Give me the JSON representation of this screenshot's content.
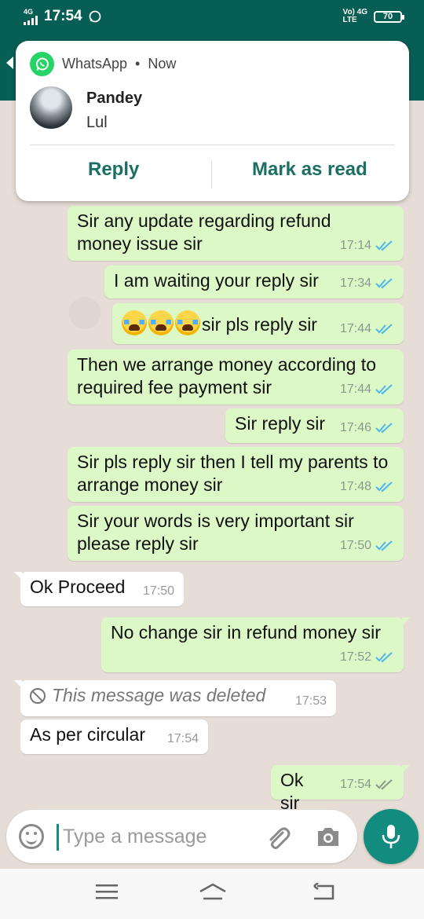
{
  "status_bar": {
    "network_small": "4G",
    "time": "17:54",
    "volte": "Vo) 4G",
    "lte": "LTE",
    "battery": "70"
  },
  "notification": {
    "app": "WhatsApp",
    "sep": "•",
    "when": "Now",
    "sender": "Pandey",
    "message": "Lul",
    "reply_label": "Reply",
    "mark_read_label": "Mark as read"
  },
  "messages": [
    {
      "dir": "out",
      "text": "Sir any update regarding refund money issue sir",
      "time": "17:14",
      "status": "read"
    },
    {
      "dir": "out",
      "text": "I am waiting your reply sir",
      "time": "17:34",
      "status": "read"
    },
    {
      "dir": "out",
      "emoji": "crying-face x3",
      "text": "sir pls reply sir",
      "time": "17:44",
      "status": "read"
    },
    {
      "dir": "out",
      "text": "Then we arrange money according to required fee payment sir",
      "time": "17:44",
      "status": "read"
    },
    {
      "dir": "out",
      "text": "Sir reply sir",
      "time": "17:46",
      "status": "read"
    },
    {
      "dir": "out",
      "text": "Sir pls reply sir then I tell my parents to arrange money sir",
      "time": "17:48",
      "status": "read"
    },
    {
      "dir": "out",
      "text": "Sir your words is very important sir please reply sir",
      "time": "17:50",
      "status": "read"
    },
    {
      "dir": "in",
      "text": "Ok Proceed",
      "time": "17:50"
    },
    {
      "dir": "out",
      "text": "No change sir in refund money sir",
      "time": "17:52",
      "status": "read"
    },
    {
      "dir": "in",
      "text": "This message was deleted",
      "time": "17:53",
      "deleted": true
    },
    {
      "dir": "in",
      "text": "As per circular",
      "time": "17:54"
    },
    {
      "dir": "out",
      "text": "Ok sir",
      "time": "17:54",
      "status": "delivered"
    }
  ],
  "composer": {
    "placeholder": "Type a message"
  },
  "colors": {
    "header": "#075e54",
    "accent": "#128c7e",
    "outgoing_bubble": "#dcf8c6",
    "read_tick": "#4fb6ec"
  }
}
